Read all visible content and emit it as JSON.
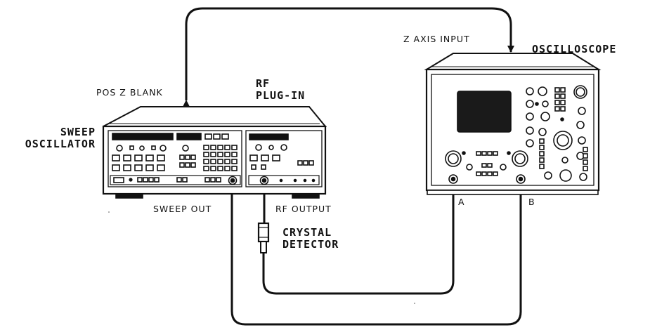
{
  "labels": {
    "z_axis_input": "Z AXIS INPUT",
    "oscilloscope": "OSCILLOSCOPE",
    "pos_z_blank": "POS Z BLANK",
    "rf_plugin_line1": "RF",
    "rf_plugin_line2": "PLUG-IN",
    "sweep_oscillator_line1": "SWEEP",
    "sweep_oscillator_line2": "OSCILLATOR",
    "sweep_out": "SWEEP OUT",
    "rf_output": "RF OUTPUT",
    "crystal_detector_line1": "CRYSTAL",
    "crystal_detector_line2": "DETECTOR",
    "channel_a": "A",
    "channel_b": "B"
  },
  "colors": {
    "line": "#111111",
    "screen": "#1a1a1a",
    "background": "#ffffff"
  }
}
